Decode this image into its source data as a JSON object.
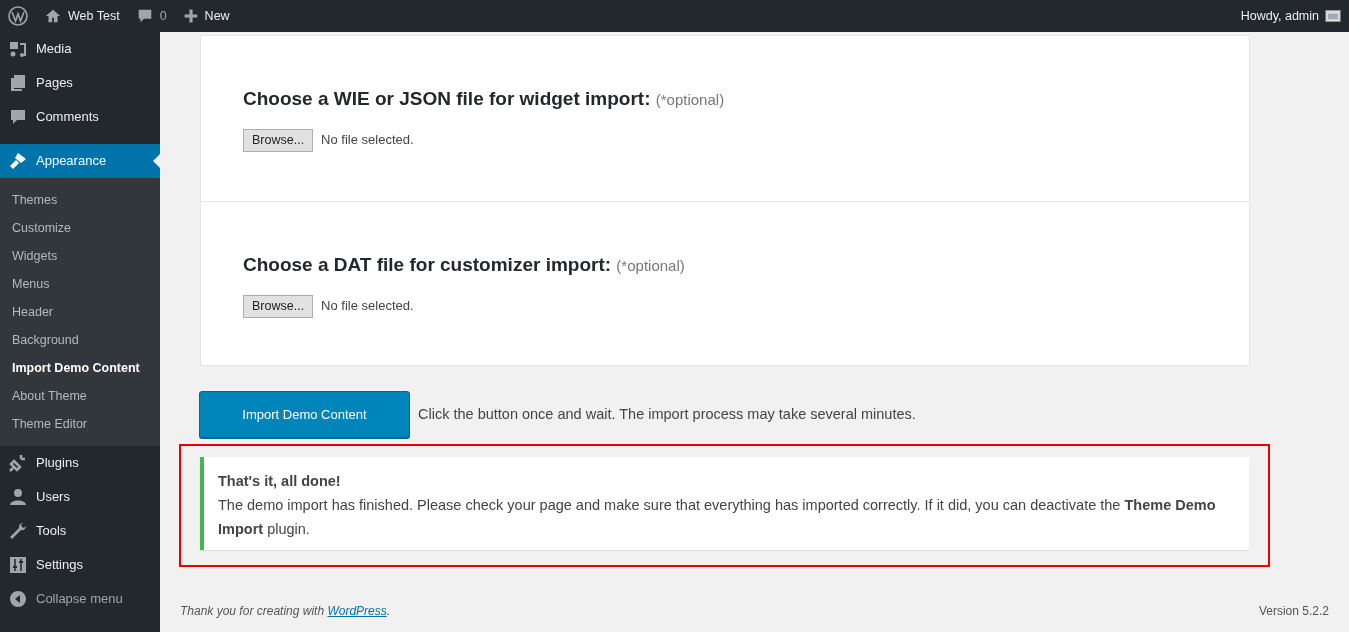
{
  "admin_bar": {
    "site": "Web Test",
    "comments_count": "0",
    "new_label": "New",
    "greeting": "Howdy, admin"
  },
  "sidebar": {
    "menu": [
      {
        "label": "Media",
        "selected": false
      },
      {
        "label": "Pages",
        "selected": false
      },
      {
        "label": "Comments",
        "selected": false
      },
      {
        "label": "Appearance",
        "selected": true,
        "children": [
          {
            "label": "Themes",
            "selected": false
          },
          {
            "label": "Customize",
            "selected": false
          },
          {
            "label": "Widgets",
            "selected": false
          },
          {
            "label": "Menus",
            "selected": false
          },
          {
            "label": "Header",
            "selected": false
          },
          {
            "label": "Background",
            "selected": false
          },
          {
            "label": "Import Demo Content",
            "selected": true
          },
          {
            "label": "About Theme",
            "selected": false
          },
          {
            "label": "Theme Editor",
            "selected": false
          }
        ]
      },
      {
        "label": "Plugins",
        "selected": false
      },
      {
        "label": "Users",
        "selected": false
      },
      {
        "label": "Tools",
        "selected": false
      },
      {
        "label": "Settings",
        "selected": false
      }
    ],
    "collapse": "Collapse menu"
  },
  "sections": [
    {
      "title": "Choose a WIE or JSON file for widget import:",
      "optional": "(*optional)",
      "browse": "Browse...",
      "file_status": "No file selected."
    },
    {
      "title": "Choose a DAT file for customizer import:",
      "optional": "(*optional)",
      "browse": "Browse...",
      "file_status": "No file selected."
    }
  ],
  "import_button": "Import Demo Content",
  "import_hint": "Click the button once and wait. The import process may take several minutes.",
  "notice": {
    "highlighted": true,
    "title": "That's it, all done!",
    "message": "The demo import has finished. Please check your page and make sure that everything has imported correctly. If it did, you can deactivate the **Theme Demo Import** plugin."
  },
  "footer": {
    "thanks": "Thank you for creating with",
    "link": "WordPress",
    "suffix": ".",
    "version": "Version 5.2.2"
  }
}
